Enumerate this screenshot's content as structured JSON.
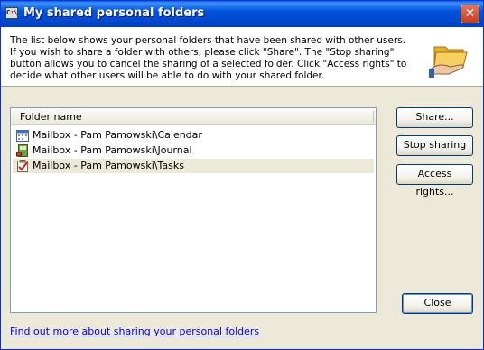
{
  "window": {
    "title": "My shared personal folders",
    "app_icon_text": "C:\\",
    "close_glyph": "✕"
  },
  "info": {
    "text": "The list below shows your personal folders that have been shared with other users. If you wish to share a folder with others, please click \"Share\". The \"Stop sharing\" button allows you to cancel the sharing of a selected folder. Click \"Access rights\" to decide what other users will be able to do with your shared folder."
  },
  "list": {
    "column_header": "Folder name",
    "items": [
      {
        "label": "Mailbox - Pam Pamowski\\Calendar",
        "icon": "calendar-icon",
        "selected": false
      },
      {
        "label": "Mailbox - Pam Pamowski\\Journal",
        "icon": "journal-icon",
        "selected": false
      },
      {
        "label": "Mailbox - Pam Pamowski\\Tasks",
        "icon": "tasks-icon",
        "selected": true
      }
    ]
  },
  "buttons": {
    "share": "Share...",
    "stop_sharing": "Stop sharing",
    "access_rights": "Access rights...",
    "close": "Close"
  },
  "footer": {
    "link_text": "Find out more about sharing your personal folders"
  },
  "colors": {
    "titlebar": "#0052de",
    "dialog_bg": "#ece9d8",
    "link": "#0000ff"
  }
}
